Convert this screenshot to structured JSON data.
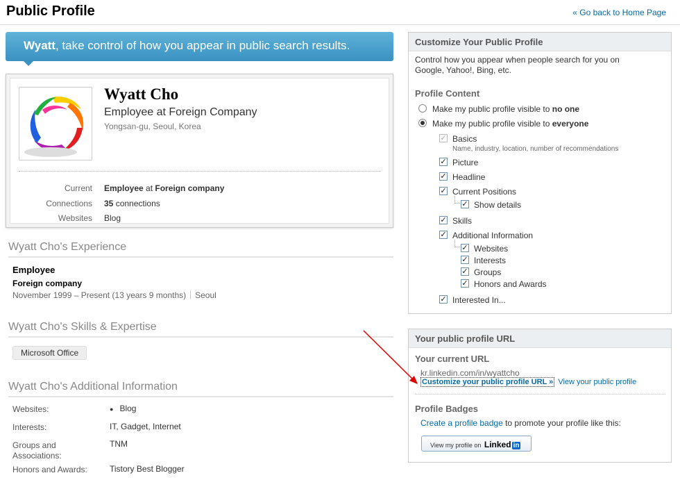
{
  "header": {
    "title": "Public Profile",
    "back_link": "« Go back to Home Page"
  },
  "banner": {
    "name": "Wyatt",
    "text": ", take control of how you appear in public search results."
  },
  "profile": {
    "name": "Wyatt Cho",
    "headline": "Employee at Foreign Company",
    "location": "Yongsan-gu, Seoul, Korea",
    "current_label": "Current",
    "current_value_bold1": "Employee",
    "current_value_mid": " at ",
    "current_value_bold2": "Foreign company",
    "connections_label": "Connections",
    "connections_count": "35",
    "connections_suffix": " connections",
    "websites_label": "Websites",
    "websites_value": "Blog"
  },
  "experience": {
    "title": "Wyatt Cho's Experience",
    "job_title": "Employee",
    "company": "Foreign company",
    "dates": "November 1999 – Present (13 years 9 months)",
    "location": "Seoul"
  },
  "skills": {
    "title": "Wyatt Cho's Skills & Expertise",
    "items": [
      "Microsoft Office"
    ]
  },
  "additional": {
    "title": "Wyatt Cho's Additional Information",
    "rows": [
      {
        "label": "Websites:",
        "value": "Blog"
      },
      {
        "label": "Interests:",
        "value": "IT, Gadget, Internet"
      },
      {
        "label": "Groups and Associations:",
        "value": "TNM"
      },
      {
        "label": "Honors and Awards:",
        "value": "Tistory Best Blogger"
      }
    ]
  },
  "customize": {
    "head": "Customize Your Public Profile",
    "desc": "Control how you appear when people search for you on Google, Yahoo!, Bing, etc.",
    "content_title": "Profile Content",
    "radio_none_prefix": "Make my public profile visible to ",
    "radio_none_bold": "no one",
    "radio_all_prefix": "Make my public profile visible to ",
    "radio_all_bold": "everyone",
    "basics": "Basics",
    "basics_sub": "Name, industry, location, number of recommendations",
    "picture": "Picture",
    "headline": "Headline",
    "current_positions": "Current Positions",
    "show_details": "Show details",
    "skills": "Skills",
    "additional_info": "Additional Information",
    "websites": "Websites",
    "interests": "Interests",
    "groups": "Groups",
    "honors": "Honors and Awards",
    "interested_in": "Interested In..."
  },
  "url_panel": {
    "head": "Your public profile URL",
    "current_title": "Your current URL",
    "url": "kr.linkedin.com/in/wyattcho",
    "customize_link": "Customize your public profile URL »",
    "view_link": "View your public profile",
    "badges_title": "Profile Badges",
    "create_badge_link": "Create a profile badge",
    "badge_suffix": " to promote your profile like this:",
    "badge_text": "View my profile on",
    "badge_brand": "Linked",
    "badge_brand_in": "in"
  },
  "colors": {
    "accent": "#066aa6",
    "banner": "#4ea2cd",
    "arrow": "#e00000"
  }
}
